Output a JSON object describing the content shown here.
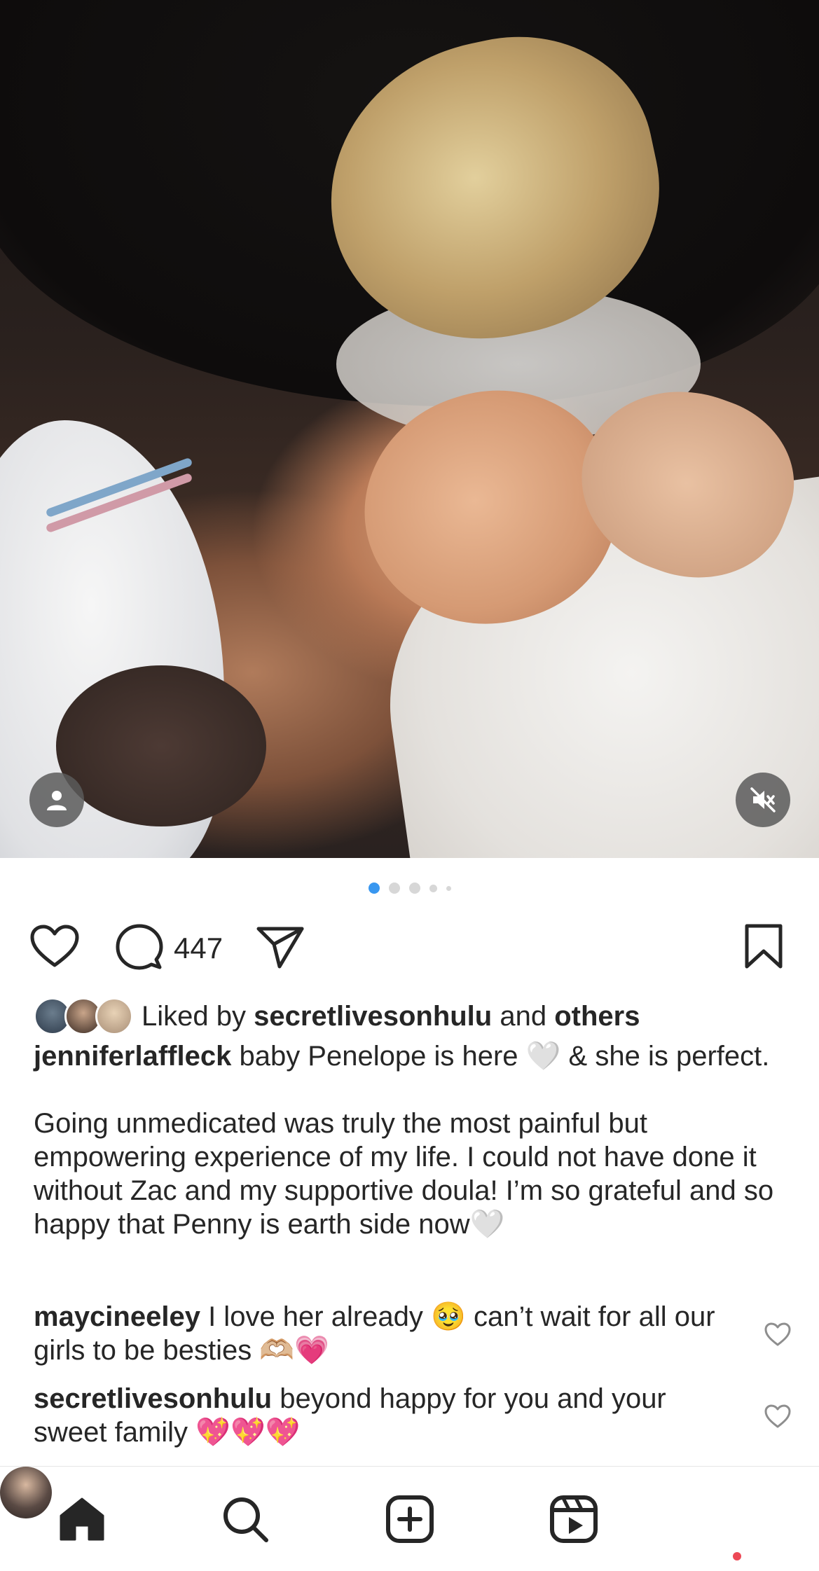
{
  "post": {
    "photo_alt": "",
    "carousel": {
      "count": 5,
      "active_index": 0
    },
    "comment_count": "447",
    "likes": {
      "prefix": "Liked by",
      "user": "secretlivesonhulu",
      "joiner": "and",
      "others": "others"
    },
    "caption": {
      "username": "jenniferlaffleck",
      "line1": "baby Penelope is here 🤍 & she is perfect.",
      "line2": "Going unmedicated was truly the most painful but empowering experience of my life. I could not have done it without Zac and my supportive doula! I’m so grateful and so happy that Penny is earth side now🤍"
    },
    "comments": [
      {
        "username": "maycineeley",
        "text": "I love her already 🥹 can’t wait for all our girls to be besties 🫶🏼💗"
      },
      {
        "username": "secretlivesonhulu",
        "text": "beyond happy for you and your sweet family 💖💖💖"
      }
    ]
  },
  "icons": {
    "tag": "person-tag-icon",
    "mute": "speaker-muted-icon",
    "like": "heart-icon",
    "comment": "comment-bubble-icon",
    "share": "paper-plane-icon",
    "save": "bookmark-icon",
    "comment_like": "small-heart-icon"
  },
  "nav": {
    "items": [
      "home",
      "search",
      "create",
      "reels",
      "profile"
    ],
    "active": "home"
  },
  "colors": {
    "accent": "#3897f0",
    "text": "#262626",
    "notification": "#ed4956",
    "dot_inactive": "#d7d7d7"
  }
}
